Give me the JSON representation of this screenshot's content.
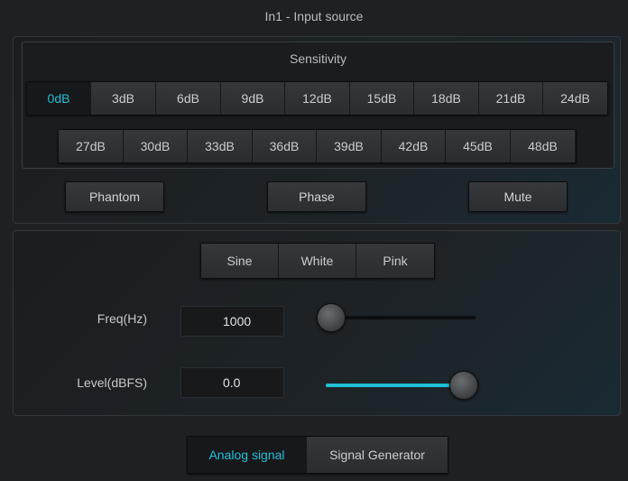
{
  "window": {
    "title": "In1 - Input source"
  },
  "sensitivity": {
    "label": "Sensitivity",
    "row1": [
      "0dB",
      "3dB",
      "6dB",
      "9dB",
      "12dB",
      "15dB",
      "18dB",
      "21dB",
      "24dB"
    ],
    "row2": [
      "27dB",
      "30dB",
      "33dB",
      "36dB",
      "39dB",
      "42dB",
      "45dB",
      "48dB"
    ],
    "selected": "0dB"
  },
  "toggles": {
    "phantom": "Phantom",
    "phase": "Phase",
    "mute": "Mute"
  },
  "generator": {
    "waveforms": [
      "Sine",
      "White",
      "Pink"
    ],
    "freq_label": "Freq(Hz)",
    "freq_value": "1000",
    "freq_slider_fraction": 0.03,
    "level_label": "Level(dBFS)",
    "level_value": "0.0",
    "level_slider_fraction": 1.0
  },
  "source_tabs": {
    "analog": "Analog signal",
    "generator": "Signal Generator",
    "active": "analog"
  },
  "colors": {
    "accent": "#1fc0d6",
    "background": "#1f2023"
  }
}
